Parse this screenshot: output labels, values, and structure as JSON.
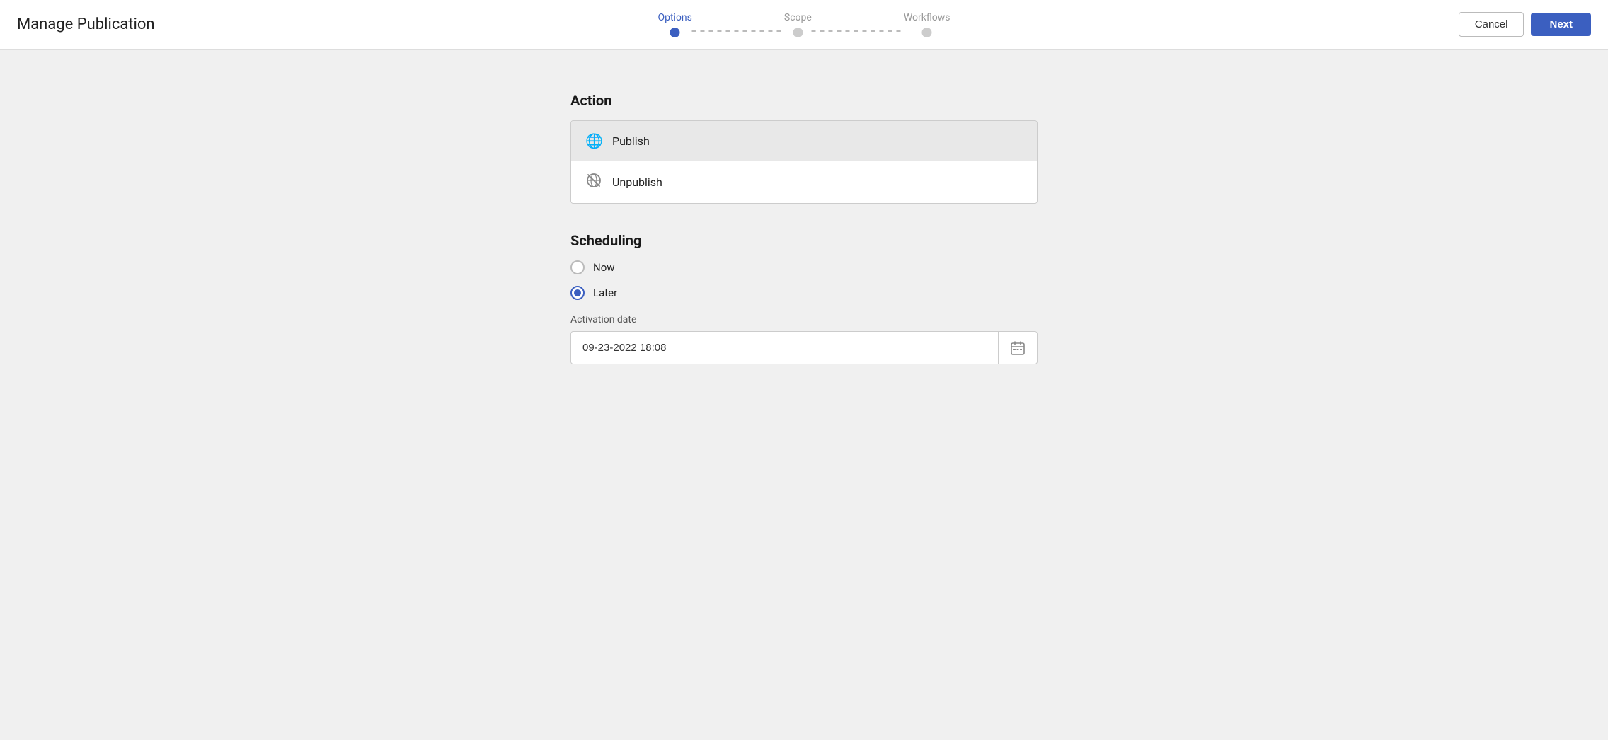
{
  "header": {
    "title": "Manage Publication",
    "cancel_label": "Cancel",
    "next_label": "Next"
  },
  "stepper": {
    "steps": [
      {
        "label": "Options",
        "state": "active"
      },
      {
        "label": "Scope",
        "state": "inactive"
      },
      {
        "label": "Workflows",
        "state": "inactive"
      }
    ]
  },
  "action_section": {
    "title": "Action",
    "items": [
      {
        "label": "Publish",
        "icon": "globe",
        "selected": true
      },
      {
        "label": "Unpublish",
        "icon": "unpublish",
        "selected": false
      }
    ]
  },
  "scheduling_section": {
    "title": "Scheduling",
    "options": [
      {
        "label": "Now",
        "checked": false
      },
      {
        "label": "Later",
        "checked": true
      }
    ],
    "activation_date_label": "Activation date",
    "activation_date_value": "09-23-2022 18:08"
  }
}
